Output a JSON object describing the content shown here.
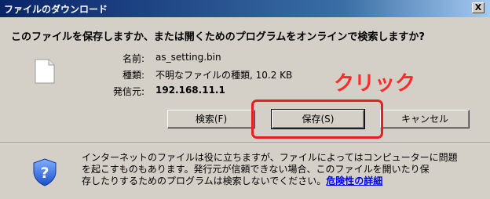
{
  "window": {
    "title": "ファイルのダウンロード",
    "close_label": "X"
  },
  "prompt": "このファイルを保存しますか、または開くためのプログラムをオンラインで検索しますか?",
  "file": {
    "icon": "blank-file-icon",
    "name_label": "名前:",
    "name_value": "as_setting.bin",
    "type_label": "種類:",
    "type_value": "不明なファイルの種類, 10.2 KB",
    "from_label": "発信元:",
    "from_value": "192.168.11.1"
  },
  "annotation": {
    "text": "クリック",
    "color": "#ff2a2a"
  },
  "buttons": {
    "search": "検索(F)",
    "save": "保存(S)",
    "cancel": "キャンセル"
  },
  "warning": {
    "icon": "shield-question-icon",
    "line1": "インターネットのファイルは役に立ちますが、ファイルによってはコンピューターに問題",
    "line2": "を起こすものもあります。発行元が信頼できない場合、このファイルを開いたり保",
    "line3": "存したりするためのプログラムは検索しないでください。",
    "link": "危険性の詳細"
  }
}
